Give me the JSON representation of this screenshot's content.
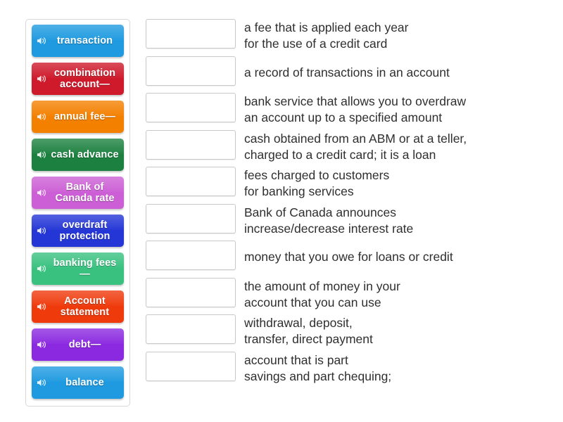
{
  "activity": {
    "type": "match-up",
    "icon_name": "speaker-icon",
    "tile_count": 10,
    "row_count": 10
  },
  "tiles": [
    {
      "label": "transaction",
      "color": "#1f9ae0"
    },
    {
      "label": "combination\naccount—",
      "color": "#ce1a2b"
    },
    {
      "label": "annual\nfee—",
      "color": "#f48000"
    },
    {
      "label": "cash\nadvance",
      "color": "#1c8140"
    },
    {
      "label": "Bank of\nCanada rate",
      "color": "#cc5fd5"
    },
    {
      "label": "overdraft\nprotection",
      "color": "#2436d6"
    },
    {
      "label": "banking\nfees—",
      "color": "#38c17f"
    },
    {
      "label": "Account\nstatement",
      "color": "#ef3a0c"
    },
    {
      "label": "debt—",
      "color": "#8b29e0"
    },
    {
      "label": "balance",
      "color": "#1f9ae0"
    }
  ],
  "rows": [
    {
      "answer": "",
      "definition": "a fee that is applied each year\nfor the use of a credit card"
    },
    {
      "answer": "",
      "definition": "a record of transactions in an account"
    },
    {
      "answer": "",
      "definition": "bank service that allows you to overdraw\nan account up to a specified amount"
    },
    {
      "answer": "",
      "definition": "cash obtained from an ABM or at a teller,\ncharged to a credit card; it is a loan"
    },
    {
      "answer": "",
      "definition": "fees charged to customers\nfor banking services"
    },
    {
      "answer": "",
      "definition": "Bank of Canada announces\nincrease/decrease interest rate"
    },
    {
      "answer": "",
      "definition": "money that you owe for loans or credit"
    },
    {
      "answer": "",
      "definition": "the amount of money in your\naccount that you can use"
    },
    {
      "answer": "",
      "definition": "withdrawal, deposit,\ntransfer, direct payment"
    },
    {
      "answer": "",
      "definition": "account that is part\nsavings and part chequing;"
    }
  ],
  "colors": {
    "page_background": "#ffffff",
    "panel_border": "#d8d8d8",
    "dropbox_border": "#c9c9c9",
    "definition_text": "#2f2f2f",
    "tile_text": "#ffffff"
  }
}
